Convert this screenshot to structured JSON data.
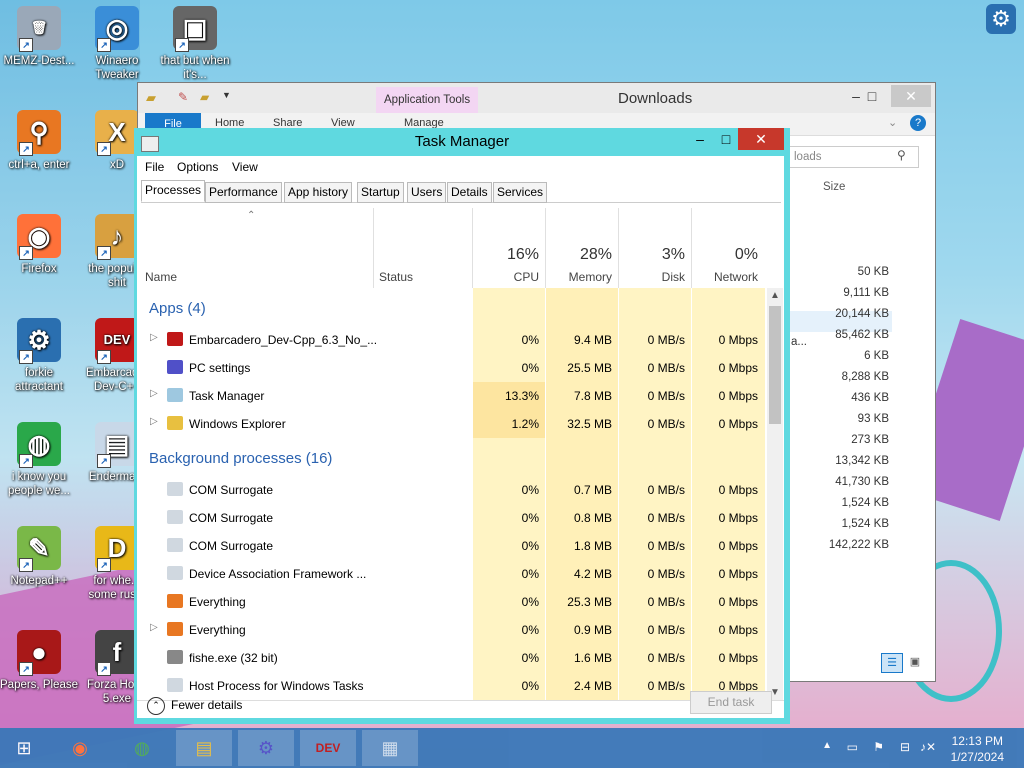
{
  "desktop": {
    "icons": [
      {
        "label": "MEMZ-Dest...",
        "glyph": "🗑",
        "color": "#9aa8b8"
      },
      {
        "label": "Winaero Tweaker",
        "glyph": "◎",
        "color": "#3a8ed8"
      },
      {
        "label": "that but when it's...",
        "glyph": "▣",
        "color": "#666666"
      },
      {
        "label": "ctrl+a, enter",
        "glyph": "⚲",
        "color": "#e87722"
      },
      {
        "label": "xD",
        "glyph": "X",
        "color": "#e8b04a"
      },
      {
        "label": "Firefox",
        "glyph": "◉",
        "color": "#ff7139"
      },
      {
        "label": "the popular shit",
        "glyph": "♪",
        "color": "#d8a040"
      },
      {
        "label": "forkie attractant",
        "glyph": "⚙",
        "color": "#2a6fb0"
      },
      {
        "label": "Embarcad... Dev-C++",
        "glyph": "DEV",
        "color": "#c01818"
      },
      {
        "label": "i know you people we...",
        "glyph": "◍",
        "color": "#2aa84a"
      },
      {
        "label": "Enderma...",
        "glyph": "▤",
        "color": "#c8d8e8"
      },
      {
        "label": "Notepad++",
        "glyph": "✎",
        "color": "#7ab848"
      },
      {
        "label": "for whe... some rus...",
        "glyph": "D",
        "color": "#e8b818"
      },
      {
        "label": "Papers, Please",
        "glyph": "●",
        "color": "#a81818"
      },
      {
        "label": "Forza Hor... 5.exe",
        "glyph": "f",
        "color": "#444444"
      }
    ],
    "settings_icon": "gear-icon"
  },
  "explorer": {
    "title": "Downloads",
    "application_tools": "Application Tools",
    "ribbon_tabs": [
      "File",
      "Home",
      "Share",
      "View",
      "Manage"
    ],
    "search_placeholder": "loads",
    "size_header": "Size",
    "sizes": [
      "50 KB",
      "9,111 KB",
      "20,144 KB",
      "85,462 KB",
      "6 KB",
      "8,288 KB",
      "436 KB",
      "93 KB",
      "273 KB",
      "13,342 KB",
      "41,730 KB",
      "1,524 KB",
      "1,524 KB",
      "142,222 KB"
    ],
    "partial_name": "a..."
  },
  "task_manager": {
    "title": "Task Manager",
    "menu": [
      "File",
      "Options",
      "View"
    ],
    "tabs": [
      "Processes",
      "Performance",
      "App history",
      "Startup",
      "Users",
      "Details",
      "Services"
    ],
    "columns": {
      "name": "Name",
      "status": "Status",
      "cpu": {
        "pct": "16%",
        "label": "CPU"
      },
      "memory": {
        "pct": "28%",
        "label": "Memory"
      },
      "disk": {
        "pct": "3%",
        "label": "Disk"
      },
      "network": {
        "pct": "0%",
        "label": "Network"
      }
    },
    "apps_group": "Apps (4)",
    "apps": [
      {
        "name": "Embarcadero_Dev-Cpp_6.3_No_...",
        "cpu": "0%",
        "mem": "9.4 MB",
        "disk": "0 MB/s",
        "net": "0 Mbps",
        "expandable": true,
        "icon": "devcpp-icon"
      },
      {
        "name": "PC settings",
        "cpu": "0%",
        "mem": "25.5 MB",
        "disk": "0 MB/s",
        "net": "0 Mbps",
        "expandable": false,
        "icon": "gear-icon"
      },
      {
        "name": "Task Manager",
        "cpu": "13.3%",
        "mem": "7.8 MB",
        "disk": "0 MB/s",
        "net": "0 Mbps",
        "expandable": true,
        "icon": "taskmanager-icon"
      },
      {
        "name": "Windows Explorer",
        "cpu": "1.2%",
        "mem": "32.5 MB",
        "disk": "0 MB/s",
        "net": "0 Mbps",
        "expandable": true,
        "icon": "folder-icon"
      }
    ],
    "bg_group": "Background processes (16)",
    "background": [
      {
        "name": "COM Surrogate",
        "cpu": "0%",
        "mem": "0.7 MB",
        "disk": "0 MB/s",
        "net": "0 Mbps",
        "expandable": false,
        "icon": "window-icon"
      },
      {
        "name": "COM Surrogate",
        "cpu": "0%",
        "mem": "0.8 MB",
        "disk": "0 MB/s",
        "net": "0 Mbps",
        "expandable": false,
        "icon": "window-icon"
      },
      {
        "name": "COM Surrogate",
        "cpu": "0%",
        "mem": "1.8 MB",
        "disk": "0 MB/s",
        "net": "0 Mbps",
        "expandable": false,
        "icon": "window-icon"
      },
      {
        "name": "Device Association Framework ...",
        "cpu": "0%",
        "mem": "4.2 MB",
        "disk": "0 MB/s",
        "net": "0 Mbps",
        "expandable": false,
        "icon": "window-icon"
      },
      {
        "name": "Everything",
        "cpu": "0%",
        "mem": "25.3 MB",
        "disk": "0 MB/s",
        "net": "0 Mbps",
        "expandable": false,
        "icon": "magnifier-icon"
      },
      {
        "name": "Everything",
        "cpu": "0%",
        "mem": "0.9 MB",
        "disk": "0 MB/s",
        "net": "0 Mbps",
        "expandable": true,
        "icon": "magnifier-icon"
      },
      {
        "name": "fishe.exe (32 bit)",
        "cpu": "0%",
        "mem": "1.6 MB",
        "disk": "0 MB/s",
        "net": "0 Mbps",
        "expandable": false,
        "icon": "fish-icon"
      },
      {
        "name": "Host Process for Windows Tasks",
        "cpu": "0%",
        "mem": "2.4 MB",
        "disk": "0 MB/s",
        "net": "0 Mbps",
        "expandable": false,
        "icon": "window-icon"
      }
    ],
    "fewer_details": "Fewer details",
    "end_task": "End task"
  },
  "taskbar": {
    "items": [
      {
        "name": "start-button",
        "glyph": "⊞"
      },
      {
        "name": "firefox-taskbar",
        "glyph": "◉"
      },
      {
        "name": "chrome-taskbar",
        "glyph": "◍"
      },
      {
        "name": "explorer-taskbar",
        "glyph": "▤"
      },
      {
        "name": "settings-taskbar",
        "glyph": "⚙"
      },
      {
        "name": "devcpp-taskbar",
        "glyph": "DEV"
      },
      {
        "name": "taskmanager-taskbar",
        "glyph": "▦"
      }
    ],
    "time": "12:13 PM",
    "date": "1/27/2024"
  },
  "colors": {
    "titlebar_accent": "#5fd9e0",
    "close_red": "#c7382b",
    "cpu_heat_high": "#fde5a0",
    "cpu_heat_low": "#fff4c4",
    "group_blue": "#2a62b0"
  }
}
